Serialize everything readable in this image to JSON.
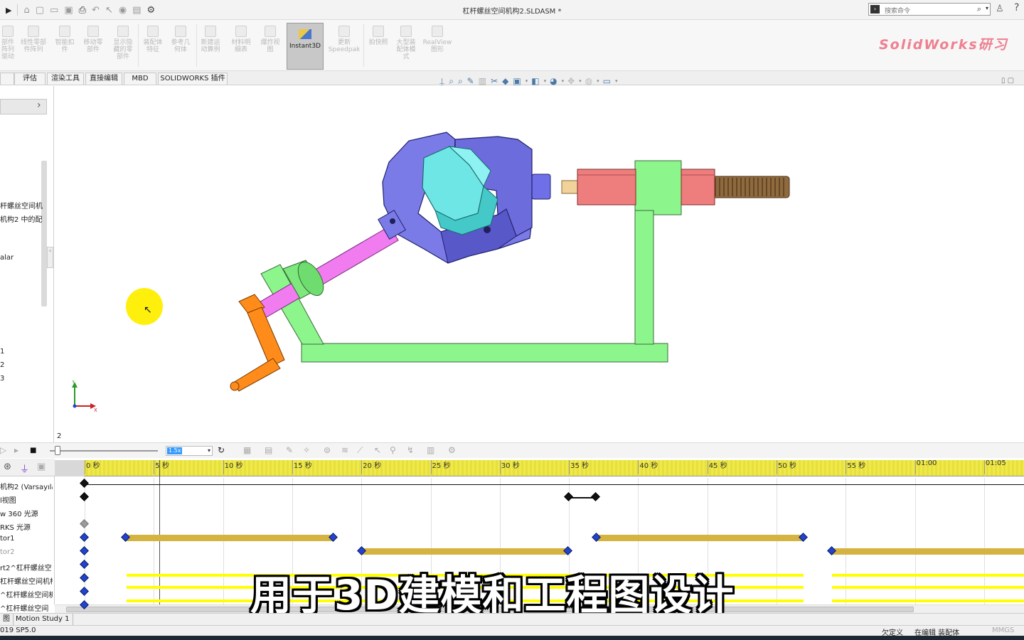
{
  "app": {
    "title": "杠杆螺丝空间机构2.SLDASM *",
    "search_placeholder": "搜索命令",
    "brand": "SolidWorks研习"
  },
  "ribbon": {
    "buttons": [
      "部件\n阵列\n驱动",
      "线性零部\n件阵列",
      "智能扣\n件",
      "移动零\n部件",
      "显示隐\n藏的零\n部件",
      "装配体\n特征",
      "参考几\n何体",
      "新建运\n动算例",
      "材料明\n细表",
      "爆炸视\n图",
      "更新\nSpeedpak",
      "拍快照",
      "大型装\n配体模\n式",
      "RealView\n图形"
    ],
    "active_button": "Instant3D"
  },
  "tabs": [
    "",
    "评估",
    "渲染工具",
    "直接编辑",
    "MBD",
    "SOLIDWORKS 插件"
  ],
  "left_panel": {
    "items": [
      "杆螺丝空间机",
      "机构2 中的配",
      "alar",
      "1",
      "2",
      "3"
    ]
  },
  "viewport": {
    "bottom_number": "2",
    "triad": {
      "y_label": "Y",
      "x_label": "X"
    }
  },
  "motion": {
    "speed": "1.5x"
  },
  "timeline": {
    "ticks": [
      "0 秒",
      "5 秒",
      "10 秒",
      "15 秒",
      "20 秒",
      "25 秒",
      "30 秒",
      "35 秒",
      "40 秒",
      "45 秒",
      "50 秒",
      "55 秒",
      "01:00",
      "01:05"
    ],
    "rows": [
      "机构2 (Varsayıla",
      "l视图",
      "w 360 光源",
      "RKS 光源",
      "tor1",
      "tor2",
      "rt2^杠杆螺丝空",
      "杠杆螺丝空间机构",
      "^杠杆螺丝空间机",
      "^杠杆螺丝空间"
    ],
    "colors": {
      "gold_bar": "#d4b341",
      "yellow_bar": "#ffff00",
      "key_blue": "#2244cc",
      "ruler": "#f0e94a"
    }
  },
  "subtitle": "用于3D建模和工程图设计",
  "study_tabs": [
    "图",
    "Motion Study 1"
  ],
  "status": {
    "version": "019 SP5.0",
    "underdefined": "欠定义",
    "editing": "在编辑 装配体",
    "units": "MMGS"
  }
}
